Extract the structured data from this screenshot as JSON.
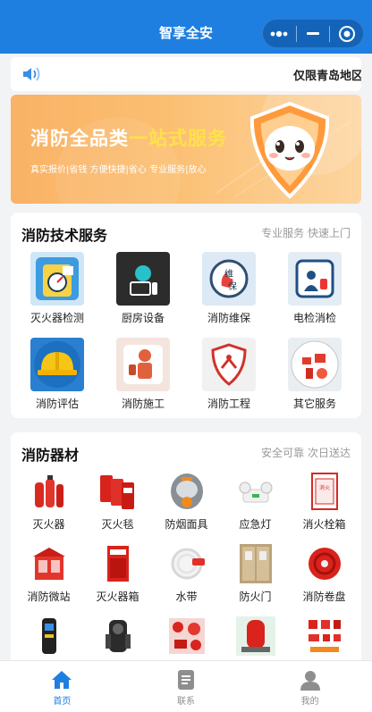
{
  "app": {
    "title": "智享全安"
  },
  "notice": {
    "text": "仅限青岛地区"
  },
  "banner": {
    "title_part1": "消防全品类",
    "title_part2": "一站式服务",
    "subtitle": "真实报价|省钱    方便快捷|省心    专业服务|放心"
  },
  "tech_services": {
    "title": "消防技术服务",
    "subtitle": "专业服务 快速上门",
    "items": [
      {
        "label": "灭火器检测",
        "icon": "extinguisher-gauge-icon"
      },
      {
        "label": "厨房设备",
        "icon": "kitchen-equipment-icon"
      },
      {
        "label": "消防维保",
        "icon": "fire-maintenance-icon"
      },
      {
        "label": "电检消检",
        "icon": "electrical-inspection-icon"
      },
      {
        "label": "消防评估",
        "icon": "safety-helmet-icon"
      },
      {
        "label": "消防施工",
        "icon": "firefighter-worker-icon"
      },
      {
        "label": "消防工程",
        "icon": "fire-engineering-shield-icon"
      },
      {
        "label": "其它服务",
        "icon": "other-services-icon"
      }
    ]
  },
  "equipment": {
    "title": "消防器材",
    "subtitle": "安全可靠 次日送达",
    "items": [
      {
        "label": "灭火器",
        "icon": "fire-extinguisher-icon"
      },
      {
        "label": "灭火毯",
        "icon": "fire-blanket-icon"
      },
      {
        "label": "防烟面具",
        "icon": "smoke-mask-icon"
      },
      {
        "label": "应急灯",
        "icon": "emergency-light-icon"
      },
      {
        "label": "消火栓箱",
        "icon": "hydrant-cabinet-icon"
      },
      {
        "label": "消防微站",
        "icon": "mini-fire-station-icon"
      },
      {
        "label": "灭火器箱",
        "icon": "extinguisher-box-icon"
      },
      {
        "label": "水带",
        "icon": "fire-hose-icon"
      },
      {
        "label": "防火门",
        "icon": "fire-door-icon"
      },
      {
        "label": "消防卷盘",
        "icon": "hose-reel-icon"
      },
      {
        "label": "",
        "icon": "detector-icon"
      },
      {
        "label": "",
        "icon": "breathing-apparatus-icon"
      },
      {
        "label": "",
        "icon": "pipe-fittings-icon"
      },
      {
        "label": "",
        "icon": "pump-set-icon"
      },
      {
        "label": "",
        "icon": "fire-accessories-icon"
      }
    ]
  },
  "tabbar": {
    "items": [
      {
        "label": "首页",
        "icon": "home-icon",
        "active": true
      },
      {
        "label": "联系",
        "icon": "document-icon",
        "active": false
      },
      {
        "label": "我的",
        "icon": "user-icon",
        "active": false
      }
    ]
  },
  "colors": {
    "brand": "#1f7fe0",
    "banner": "#f9b266",
    "highlight": "#ffe14a"
  }
}
